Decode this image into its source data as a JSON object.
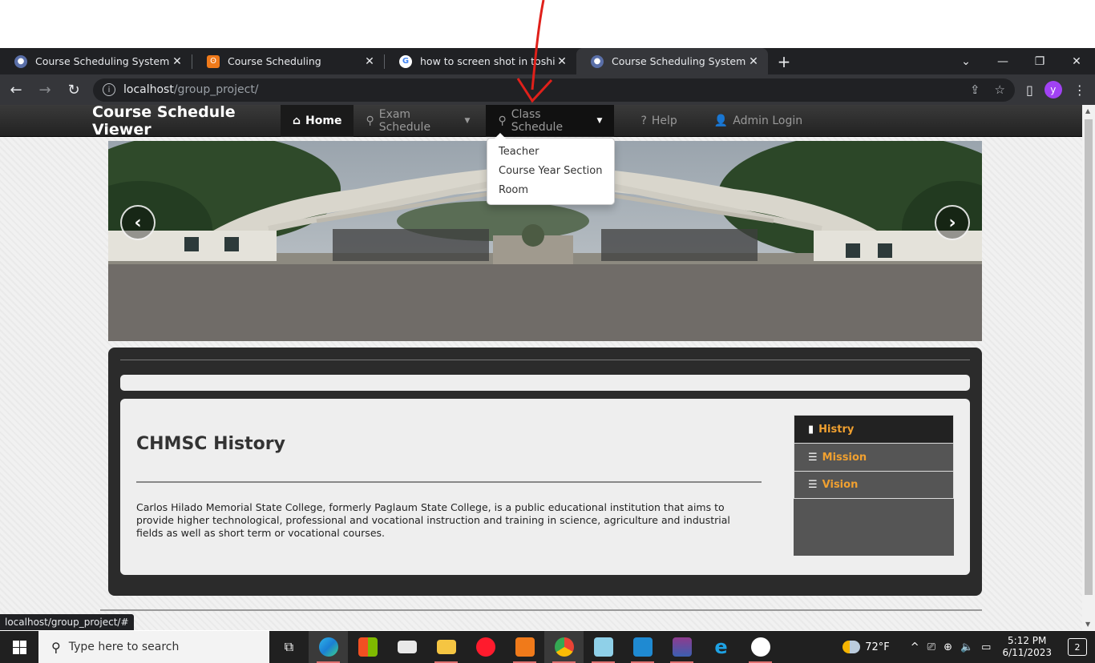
{
  "browser": {
    "tabs": [
      {
        "title": "Course Scheduling System",
        "active": false,
        "favicon_color": "#5a6fa8"
      },
      {
        "title": "Course Scheduling",
        "active": false,
        "favicon_color": "#f07a1a"
      },
      {
        "title": "how to screen shot in toshiba pc",
        "active": false,
        "favicon_color": "#4285f4"
      },
      {
        "title": "Course Scheduling System",
        "active": true,
        "favicon_color": "#5a6fa8"
      }
    ],
    "url_host": "localhost",
    "url_path": "/group_project/",
    "profile_initial": "y"
  },
  "site": {
    "brand": "Course Schedule Viewer",
    "nav": {
      "home": "Home",
      "exam_schedule": "Exam Schedule",
      "class_schedule": "Class Schedule",
      "help": "Help",
      "admin_login": "Admin Login"
    },
    "dropdown": [
      "Teacher",
      "Course Year Section",
      "Room"
    ],
    "history_title": "CHMSC History",
    "history_text": "Carlos Hilado Memorial State College, formerly Paglaum State College, is a public educational institution that aims to provide higher technological, professional and vocational instruction and training in science, agriculture and industrial fields as well as short term or vocational courses.",
    "side_menu": [
      "Histry",
      "Mission",
      "Vision"
    ],
    "accent_color": "#f0a030"
  },
  "status_url": "localhost/group_project/#",
  "taskbar": {
    "search_placeholder": "Type here to search",
    "weather": "72°F",
    "time": "5:12 PM",
    "date": "6/11/2023",
    "notification_count": "2"
  }
}
